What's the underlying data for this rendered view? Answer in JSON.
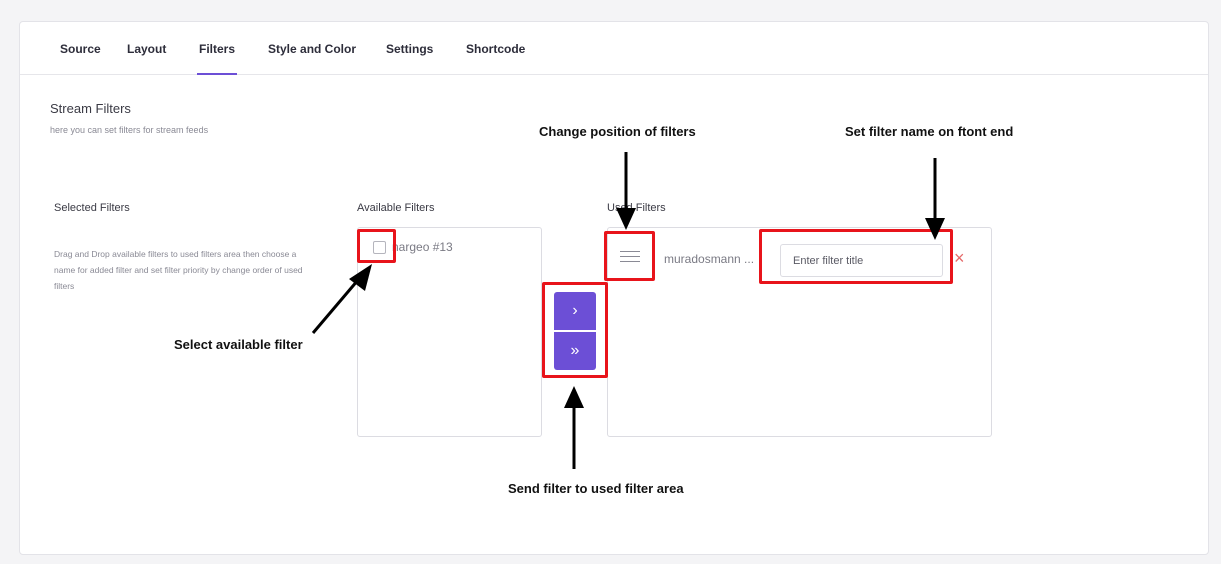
{
  "tabs": [
    {
      "label": "Source"
    },
    {
      "label": "Layout"
    },
    {
      "label": "Filters",
      "active": true
    },
    {
      "label": "Style and Color"
    },
    {
      "label": "Settings"
    },
    {
      "label": "Shortcode"
    }
  ],
  "section": {
    "title": "Stream Filters",
    "description": "here you can set filters for stream feeds"
  },
  "selected_filters": {
    "title": "Selected Filters",
    "help": "Drag and Drop available filters to used filters area then choose a name for added filter and set filter priority by change order of used filters"
  },
  "available_filters": {
    "title": "Available Filters",
    "items": [
      {
        "label": "nargeo #13",
        "checked": false
      }
    ]
  },
  "buttons": {
    "move_one": "›",
    "move_all": "»"
  },
  "used_filters": {
    "title": "Used Filters",
    "items": [
      {
        "label": "muradosmann ...",
        "title_placeholder": "Enter filter title",
        "remove_icon": "×"
      }
    ]
  },
  "annotations": {
    "change_position": "Change position of filters",
    "set_name": "Set filter name on ftont end",
    "select_filter": "Select available filter",
    "send_filter": "Send filter to used filter area"
  },
  "colors": {
    "accent": "#6c4fd6",
    "callout": "#e8141b",
    "remove": "#e56a6a"
  }
}
